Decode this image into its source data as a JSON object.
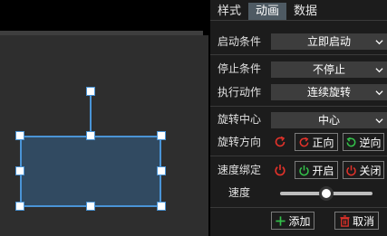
{
  "tabs": [
    {
      "label": "样式",
      "active": false
    },
    {
      "label": "动画",
      "active": true
    },
    {
      "label": "数据",
      "active": false
    }
  ],
  "animation": {
    "start_condition": {
      "label": "启动条件",
      "value": "立即启动"
    },
    "stop_condition": {
      "label": "停止条件",
      "value": "不停止"
    },
    "action": {
      "label": "执行动作",
      "value": "连续旋转"
    },
    "rotation_center": {
      "label": "旋转中心",
      "value": "中心"
    },
    "rotation_direction": {
      "label": "旋转方向",
      "forward_label": "正向",
      "reverse_label": "逆向"
    },
    "speed_binding": {
      "label": "速度绑定",
      "on_label": "开启",
      "off_label": "关闭"
    },
    "speed": {
      "label": "速度",
      "level": 0.5
    }
  },
  "footer": {
    "add_label": "添加",
    "cancel_label": "取消"
  },
  "colors": {
    "accent_red": "#e2322a",
    "accent_green": "#33c14a",
    "selection_blue": "#4a94d6",
    "shape_fill": "#314a61"
  },
  "icons": {
    "chevron": "chevron-down-icon",
    "rotate": "rotate-icon",
    "forward": "rotate-cw-icon",
    "reverse": "rotate-ccw-icon",
    "power": "power-icon",
    "add": "plus-icon",
    "delete": "trash-icon"
  }
}
